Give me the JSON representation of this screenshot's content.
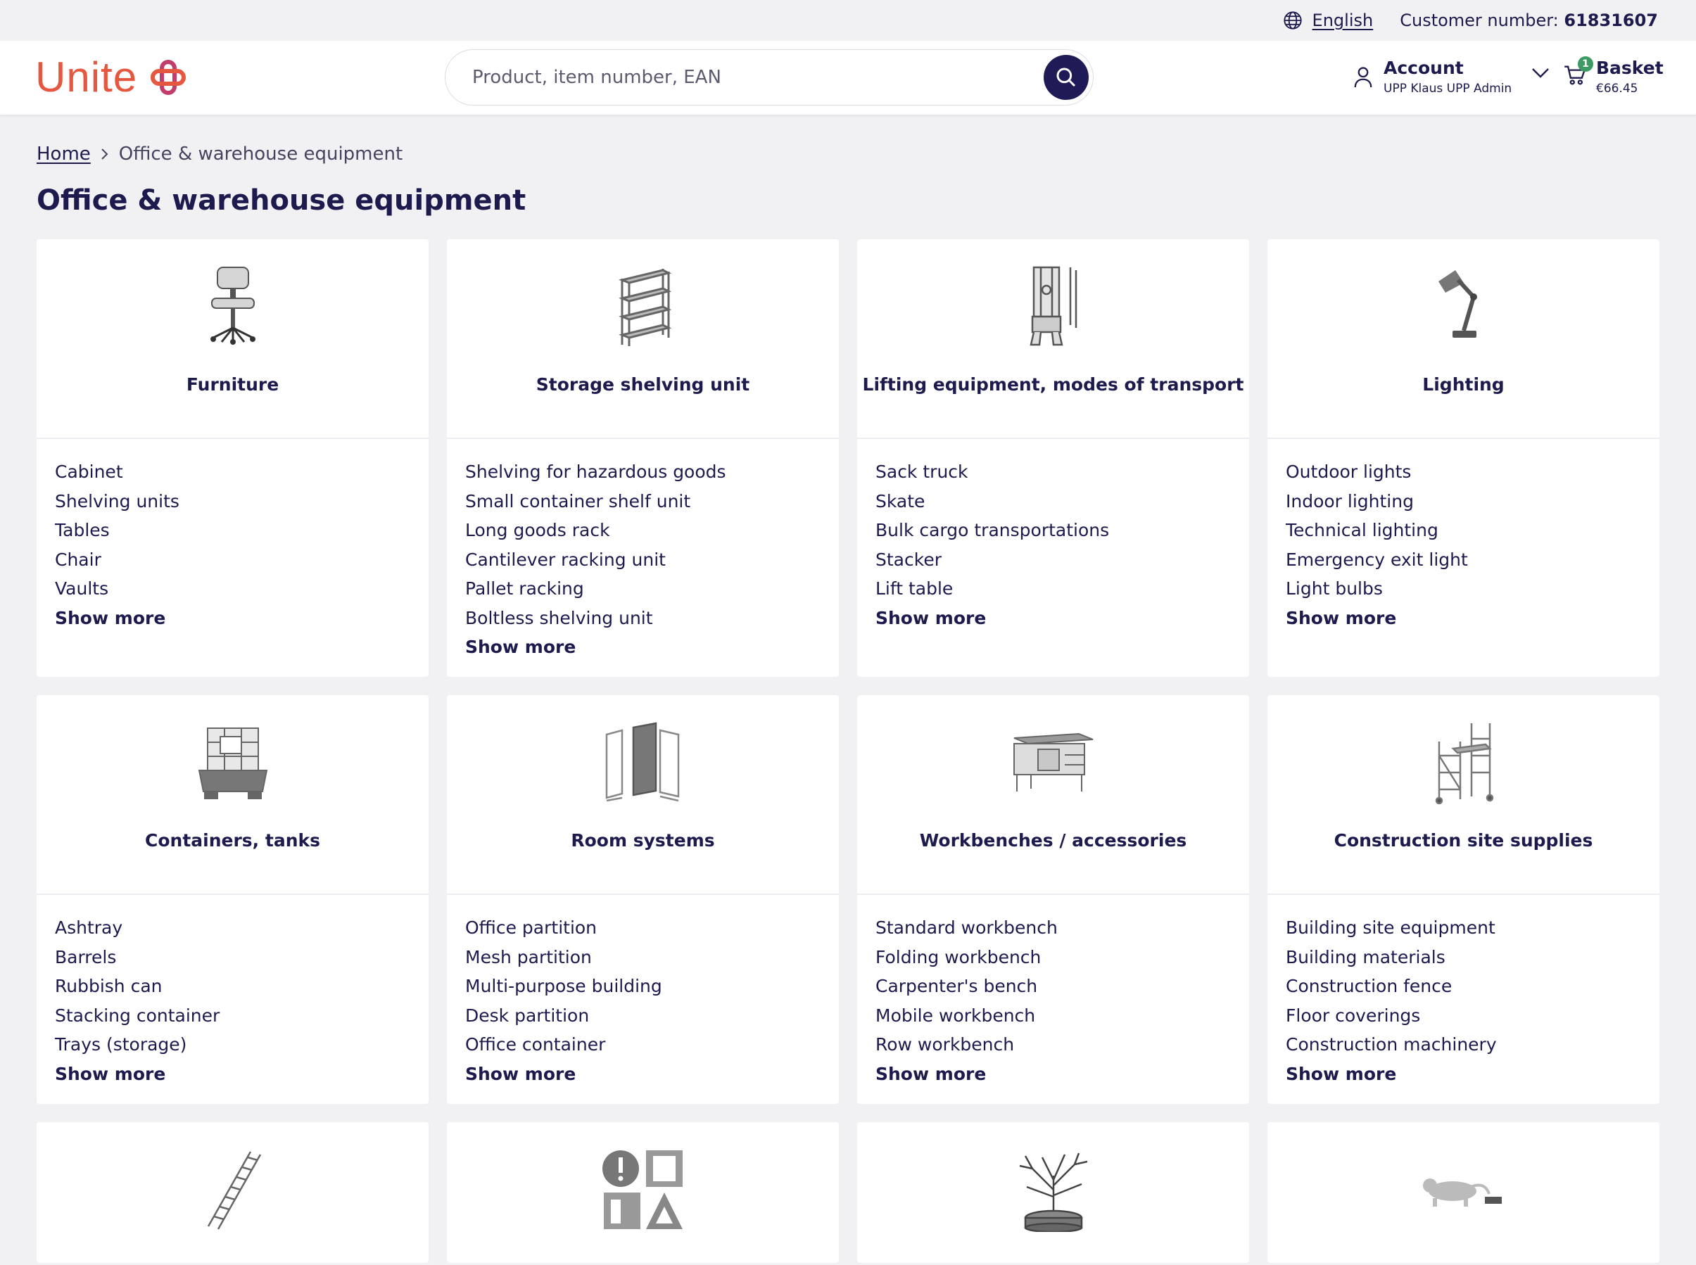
{
  "utility": {
    "language": "English",
    "customer_label": "Customer number:",
    "customer_number": "61831607"
  },
  "header": {
    "logo_text": "Unite",
    "search_placeholder": "Product, item number, EAN",
    "account": {
      "title": "Account",
      "user": "UPP Klaus UPP Admin"
    },
    "basket": {
      "title": "Basket",
      "amount": "€66.45",
      "count": "1"
    }
  },
  "breadcrumb": {
    "home": "Home",
    "current": "Office & warehouse equipment"
  },
  "page_title": "Office & warehouse equipment",
  "show_more_label": "Show more",
  "categories": [
    {
      "title": "Furniture",
      "icon": "office-chair-icon",
      "items": [
        "Cabinet",
        "Shelving units",
        "Tables",
        "Chair",
        "Vaults"
      ]
    },
    {
      "title": "Storage shelving unit",
      "icon": "shelving-rack-icon",
      "items": [
        "Shelving for hazardous goods",
        "Small container shelf unit",
        "Long goods rack",
        "Cantilever racking unit",
        "Pallet racking",
        "Boltless shelving unit"
      ]
    },
    {
      "title": "Lifting equipment, modes of transport",
      "icon": "lift-stacker-icon",
      "items": [
        "Sack truck",
        "Skate",
        "Bulk cargo transportations",
        "Stacker",
        "Lift table"
      ]
    },
    {
      "title": "Lighting",
      "icon": "desk-lamp-icon",
      "items": [
        "Outdoor lights",
        "Indoor lighting",
        "Technical lighting",
        "Emergency exit light",
        "Light bulbs"
      ]
    },
    {
      "title": "Containers, tanks",
      "icon": "ibc-tank-icon",
      "items": [
        "Ashtray",
        "Barrels",
        "Rubbish can",
        "Stacking container",
        "Trays (storage)"
      ]
    },
    {
      "title": "Room systems",
      "icon": "partition-screen-icon",
      "items": [
        "Office partition",
        "Mesh partition",
        "Multi-purpose building",
        "Desk partition",
        "Office container"
      ]
    },
    {
      "title": "Workbenches / accessories",
      "icon": "workbench-icon",
      "items": [
        "Standard workbench",
        "Folding workbench",
        "Carpenter's bench",
        "Mobile workbench",
        "Row workbench"
      ]
    },
    {
      "title": "Construction site supplies",
      "icon": "scaffold-icon",
      "items": [
        "Building site equipment",
        "Building materials",
        "Construction fence",
        "Floor coverings",
        "Construction machinery"
      ]
    }
  ],
  "partial_categories": [
    {
      "icon": "ladder-icon"
    },
    {
      "icon": "safety-signs-icon"
    },
    {
      "icon": "tree-planter-icon"
    },
    {
      "icon": "animal-trap-icon"
    }
  ]
}
